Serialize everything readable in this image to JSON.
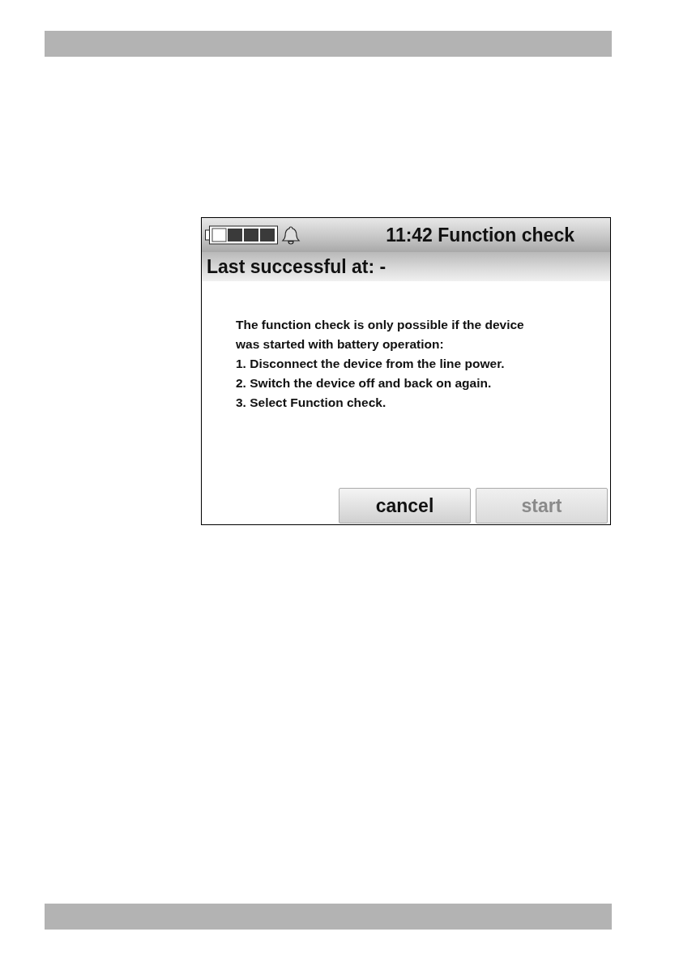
{
  "screen": {
    "title": "11:42 Function check",
    "subtitle": "Last successful at: -",
    "message": [
      "The function check is only possible if the device",
      "was started with battery operation:",
      "1. Disconnect the device from the line power.",
      "2. Switch the device off and back on again.",
      "3. Select Function check."
    ],
    "buttons": [
      {
        "label": "cancel",
        "disabled": false
      },
      {
        "label": "start",
        "disabled": true
      }
    ]
  }
}
